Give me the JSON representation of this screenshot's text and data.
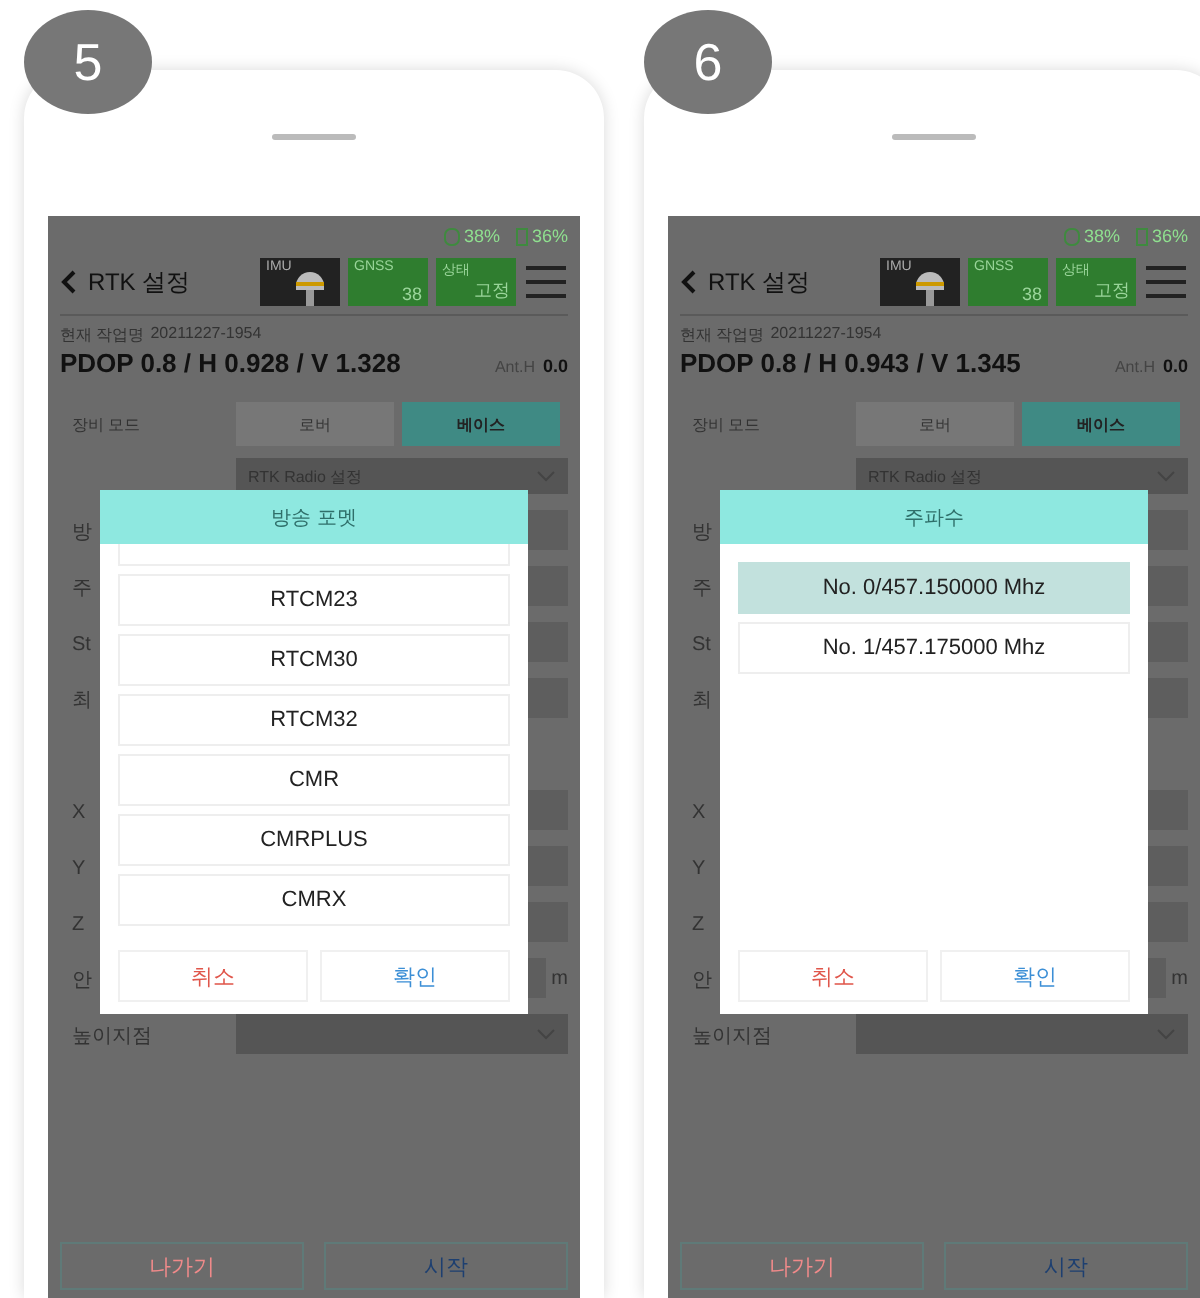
{
  "phones": [
    {
      "step": "5",
      "status": {
        "gps": "38%",
        "battery": "36%"
      },
      "title": "RTK 설정",
      "badges": [
        {
          "kind": "imu",
          "label": "IMU"
        },
        {
          "kind": "value",
          "label": "GNSS",
          "value": "38"
        },
        {
          "kind": "value",
          "label": "상태",
          "value": "고정"
        }
      ],
      "job_label": "현재 작업명",
      "job": "20211227-1954",
      "pdop": "PDOP 0.8 / H 0.928 / V 1.328",
      "ant_label": "Ant.H",
      "ant_value": "0.0",
      "mode_label": "장비 모드",
      "mode_options": [
        {
          "label": "로버",
          "selected": false
        },
        {
          "label": "베이스",
          "selected": true
        }
      ],
      "radio_dropdown": "RTK Radio 설정",
      "rows": [
        "방",
        "주",
        "St",
        "최",
        "X",
        "Y",
        "Z",
        "안"
      ],
      "unit": "m",
      "height_label": "높이지점",
      "dialog": {
        "title": "방송 포멧",
        "scrolled": true,
        "items": [
          {
            "label": "RTCM23",
            "selected": false
          },
          {
            "label": "RTCM30",
            "selected": false
          },
          {
            "label": "RTCM32",
            "selected": false
          },
          {
            "label": "CMR",
            "selected": false
          },
          {
            "label": "CMRPLUS",
            "selected": false
          },
          {
            "label": "CMRX",
            "selected": false
          }
        ],
        "cancel": "취소",
        "ok": "확인"
      },
      "footer": {
        "exit": "나가기",
        "start": "시작"
      }
    },
    {
      "step": "6",
      "status": {
        "gps": "38%",
        "battery": "36%"
      },
      "title": "RTK 설정",
      "badges": [
        {
          "kind": "imu",
          "label": "IMU"
        },
        {
          "kind": "value",
          "label": "GNSS",
          "value": "38"
        },
        {
          "kind": "value",
          "label": "상태",
          "value": "고정"
        }
      ],
      "job_label": "현재 작업명",
      "job": "20211227-1954",
      "pdop": "PDOP 0.8 / H 0.943 / V 1.345",
      "ant_label": "Ant.H",
      "ant_value": "0.0",
      "mode_label": "장비 모드",
      "mode_options": [
        {
          "label": "로버",
          "selected": false
        },
        {
          "label": "베이스",
          "selected": true
        }
      ],
      "radio_dropdown": "RTK Radio 설정",
      "rows": [
        "방",
        "주",
        "St",
        "최",
        "X",
        "Y",
        "Z",
        "안"
      ],
      "unit": "m",
      "height_label": "높이지점",
      "dialog": {
        "title": "주파수",
        "items": [
          {
            "label": "No. 0/457.150000 Mhz",
            "selected": true
          },
          {
            "label": "No. 1/457.175000 Mhz",
            "selected": false
          }
        ],
        "cancel": "취소",
        "ok": "확인"
      },
      "footer": {
        "exit": "나가기",
        "start": "시작"
      }
    }
  ]
}
